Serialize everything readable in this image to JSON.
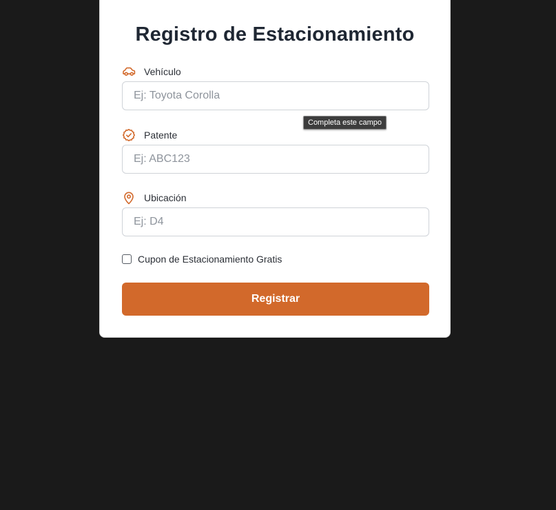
{
  "form": {
    "title": "Registro de Estacionamiento",
    "accent_color": "#d2692b",
    "fields": {
      "vehicle": {
        "label": "Vehículo",
        "icon": "car-icon",
        "value": "",
        "placeholder": "Ej: Toyota Corolla"
      },
      "plate": {
        "label": "Patente",
        "icon": "badge-check-icon",
        "value": "",
        "placeholder": "Ej: ABC123"
      },
      "location": {
        "label": "Ubicación",
        "icon": "map-pin-icon",
        "value": "",
        "placeholder": "Ej: D4"
      }
    },
    "coupon": {
      "label": "Cupon de Estacionamiento Gratis",
      "checked": false
    },
    "submit_label": "Registrar",
    "validation_tooltip": "Completa este campo"
  }
}
